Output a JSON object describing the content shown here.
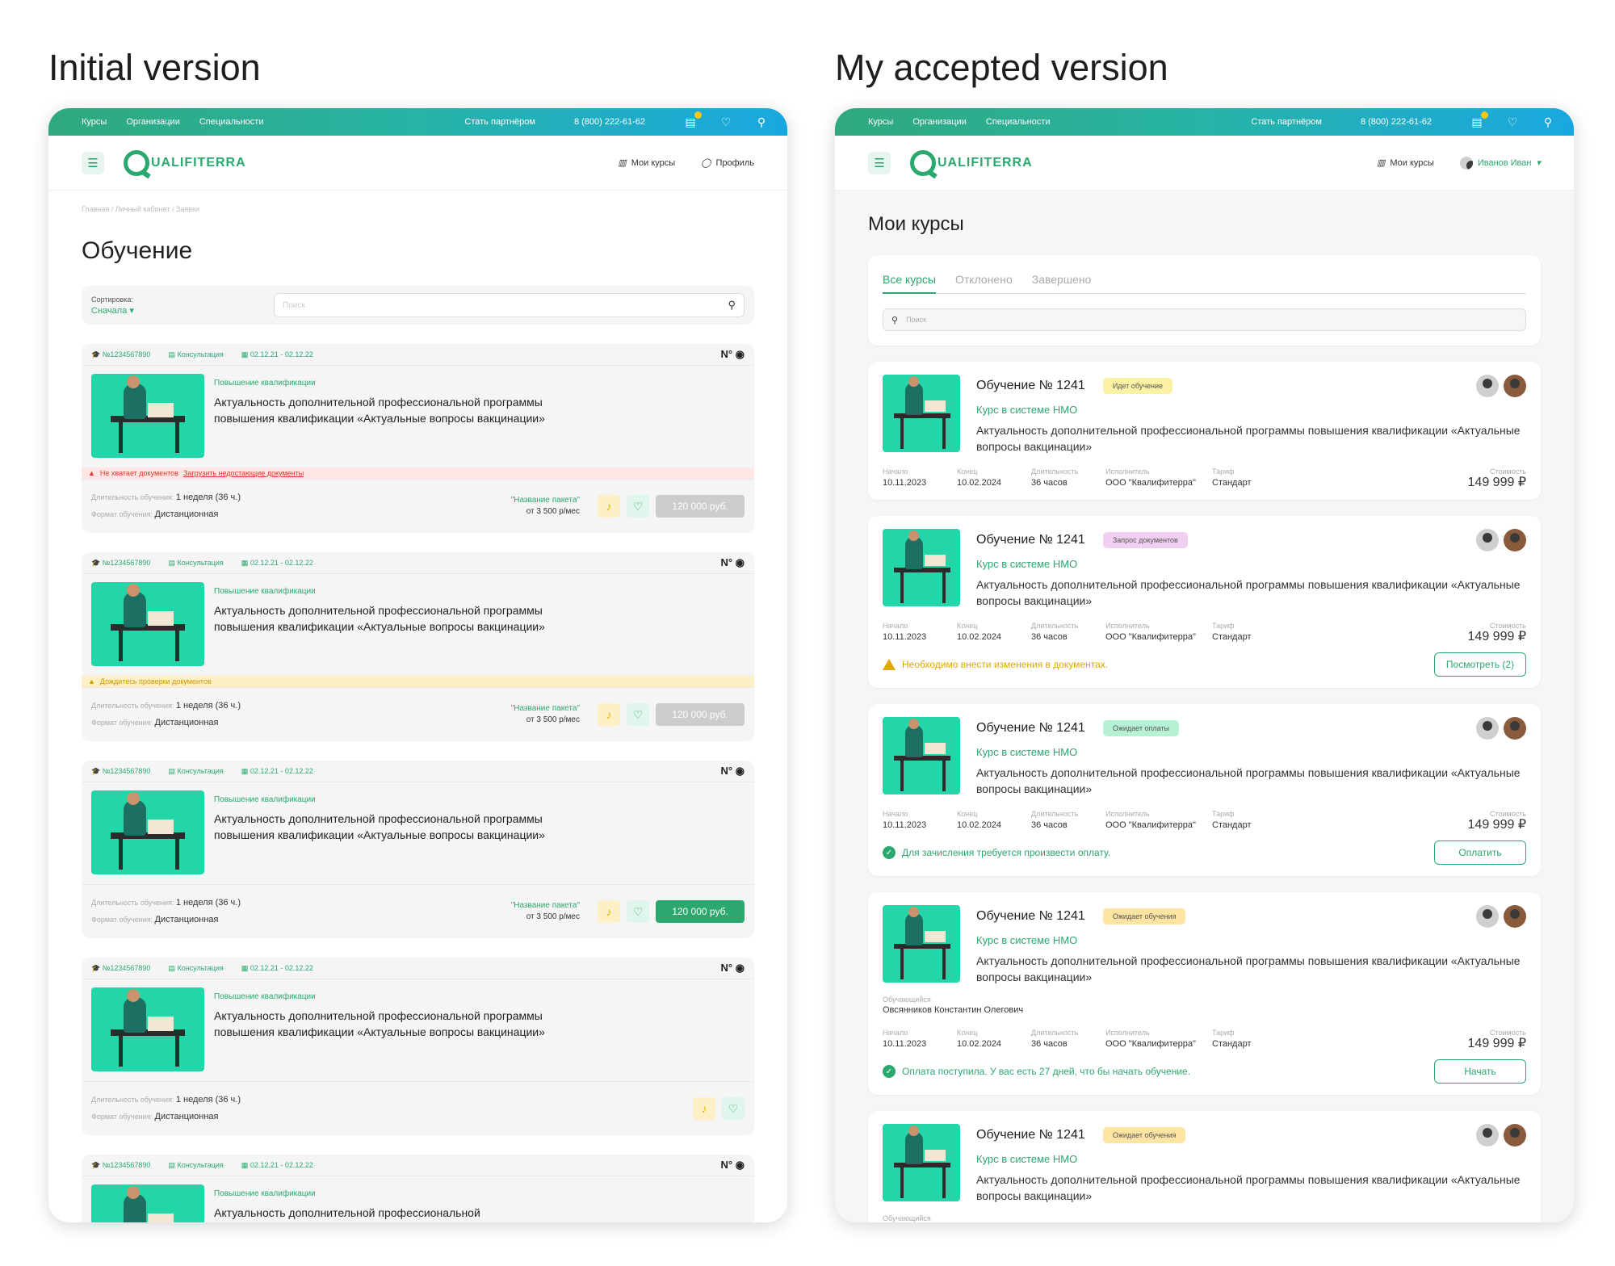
{
  "captions": {
    "left": "Initial version",
    "right": "My accepted version"
  },
  "topnav": {
    "items": [
      "Курсы",
      "Организации",
      "Специальности"
    ],
    "partner": "Стать партнёром",
    "phone": "8 (800) 222-61-62"
  },
  "logo_text": "UALIFITERRA",
  "left": {
    "header": {
      "my_courses": "Мои курсы",
      "profile": "Профиль"
    },
    "breadcrumb": "Главная / Личный кабинет / Заявки",
    "title": "Обучение",
    "sort": {
      "label": "Сортировка:",
      "value": "Сначала"
    },
    "search_placeholder": "Поиск",
    "cards": [
      {
        "id": "№1234567890",
        "type": "Консультация",
        "dates": "02.12.21 - 02.12.22",
        "nmo": "N°",
        "kind": "Повышение квалификации",
        "title": "Актуальность дополнительной профессиональной программы повышения квалификации «Актуальные вопросы вакцинации»",
        "warn": "Не хватает документов",
        "warn_link": "Загрузить недостающие документы",
        "dur_label": "Длительность обучения:",
        "dur": "1 неделя (36 ч.)",
        "fmt_label": "Формат обучения:",
        "fmt": "Дистанционная",
        "pkg": "\"Название пакета\"",
        "pkg_price": "от 3 500 р/мес",
        "price": "120 000 руб."
      },
      {
        "id": "№1234567890",
        "type": "Консультация",
        "dates": "02.12.21 - 02.12.22",
        "nmo": "N°",
        "kind": "Повышение квалификации",
        "title": "Актуальность дополнительной профессиональной программы повышения квалификации «Актуальные вопросы вакцинации»",
        "warn": "Дождитесь проверки документов",
        "dur_label": "Длительность обучения:",
        "dur": "1 неделя (36 ч.)",
        "fmt_label": "Формат обучения:",
        "fmt": "Дистанционная",
        "pkg": "\"Название пакета\"",
        "pkg_price": "от 3 500 р/мес",
        "price": "120 000 руб."
      },
      {
        "id": "№1234567890",
        "type": "Консультация",
        "dates": "02.12.21 - 02.12.22",
        "nmo": "N°",
        "kind": "Повышение квалификации",
        "title": "Актуальность дополнительной профессиональной программы повышения квалификации «Актуальные вопросы вакцинации»",
        "dur_label": "Длительность обучения:",
        "dur": "1 неделя (36 ч.)",
        "fmt_label": "Формат обучения:",
        "fmt": "Дистанционная",
        "pkg": "\"Название пакета\"",
        "pkg_price": "от 3 500 р/мес",
        "price": "120 000 руб."
      },
      {
        "id": "№1234567890",
        "type": "Консультация",
        "dates": "02.12.21 - 02.12.22",
        "nmo": "N°",
        "kind": "Повышение квалификации",
        "title": "Актуальность дополнительной профессиональной программы повышения квалификации «Актуальные вопросы вакцинации»",
        "dur_label": "Длительность обучения:",
        "dur": "1 неделя (36 ч.)",
        "fmt_label": "Формат обучения:",
        "fmt": "Дистанционная"
      },
      {
        "id": "№1234567890",
        "type": "Консультация",
        "dates": "02.12.21 - 02.12.22",
        "nmo": "N°",
        "kind": "Повышение квалификации",
        "title": "Актуальность дополнительной профессиональной"
      }
    ]
  },
  "right": {
    "header": {
      "my_courses": "Мои курсы",
      "user": "Иванов Иван"
    },
    "title": "Мои курсы",
    "tabs": [
      "Все курсы",
      "Отклонено",
      "Завершено"
    ],
    "search_placeholder": "Поиск",
    "meta_labels": {
      "start": "Начало",
      "end": "Конец",
      "dur": "Длительность",
      "exec": "Исполнитель",
      "tariff": "Тариф",
      "cost": "Стоимость",
      "learner": "Обучающийся"
    },
    "cards": [
      {
        "title": "Обучение № 1241",
        "status": "Идет обучение",
        "sub": "Курс в системе НМО",
        "desc": "Актуальность дополнительной профессиональной программы повышения квалификации «Актуальные вопросы вакцинации»",
        "start": "10.11.2023",
        "end": "10.02.2024",
        "dur": "36 часов",
        "exec": "ООО \"Квалифитерра\"",
        "tariff": "Стандарт",
        "cost": "149 999 ₽"
      },
      {
        "title": "Обучение № 1241",
        "status": "Запрос документов",
        "sub": "Курс в системе НМО",
        "desc": "Актуальность дополнительной профессиональной программы повышения квалификации «Актуальные вопросы вакцинации»",
        "start": "10.11.2023",
        "end": "10.02.2024",
        "dur": "36 часов",
        "exec": "ООО \"Квалифитерра\"",
        "tariff": "Стандарт",
        "cost": "149 999 ₽",
        "msg": "Необходимо внести изменения в документах.",
        "btn": "Посмотреть (2)"
      },
      {
        "title": "Обучение № 1241",
        "status": "Ожидает оплаты",
        "sub": "Курс в системе НМО",
        "desc": "Актуальность дополнительной профессиональной программы повышения квалификации «Актуальные вопросы вакцинации»",
        "start": "10.11.2023",
        "end": "10.02.2024",
        "dur": "36 часов",
        "exec": "ООО \"Квалифитерра\"",
        "tariff": "Стандарт",
        "cost": "149 999 ₽",
        "msg": "Для зачисления требуется произвести оплату.",
        "btn": "Оплатить"
      },
      {
        "title": "Обучение № 1241",
        "status": "Ожидает обучения",
        "sub": "Курс в системе НМО",
        "desc": "Актуальность дополнительной профессиональной программы повышения квалификации «Актуальные вопросы вакцинации»",
        "learner": "Овсянников Константин Олегович",
        "start": "10.11.2023",
        "end": "10.02.2024",
        "dur": "36 часов",
        "exec": "ООО \"Квалифитерра\"",
        "tariff": "Стандарт",
        "cost": "149 999 ₽",
        "msg": "Оплата поступила. У вас есть 27 дней, что бы начать обучение.",
        "btn": "Начать"
      },
      {
        "title": "Обучение № 1241",
        "status": "Ожидает обучения",
        "sub": "Курс в системе НМО",
        "desc": "Актуальность дополнительной профессиональной программы повышения квалификации «Актуальные вопросы вакцинации»"
      }
    ]
  }
}
